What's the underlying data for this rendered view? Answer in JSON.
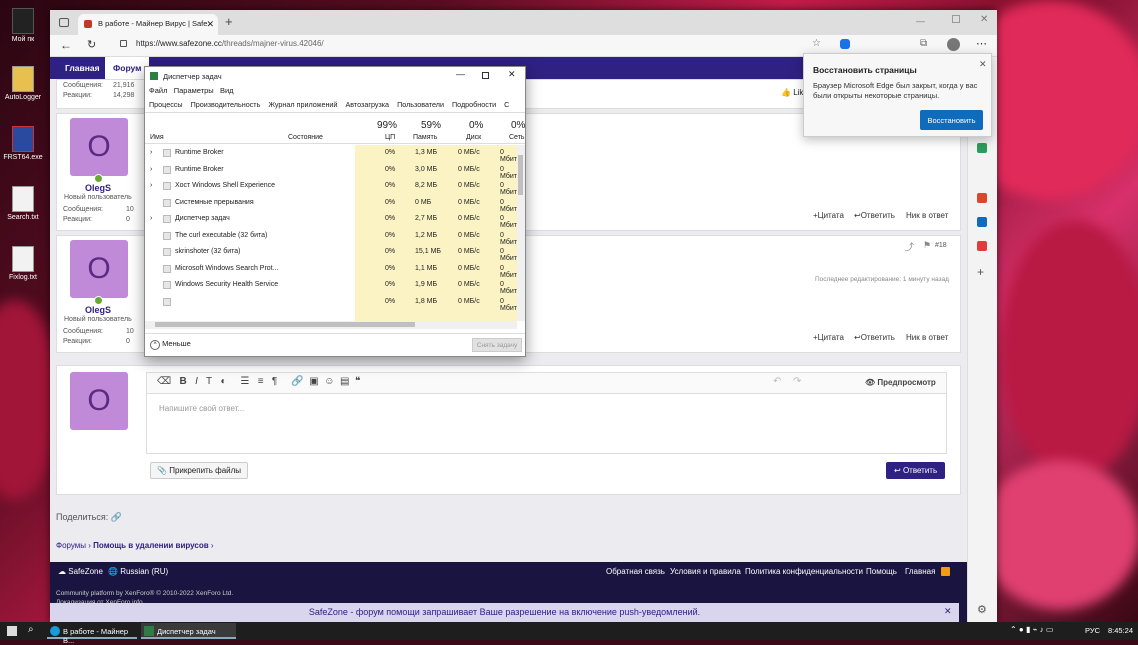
{
  "desktop": {
    "icons": [
      {
        "label": "Мой пк"
      },
      {
        "label": "AutoLogger"
      },
      {
        "label": "FRST64.exe"
      },
      {
        "label": "Search.txt"
      },
      {
        "label": "Fixlog.txt"
      }
    ]
  },
  "browser": {
    "tab_title": "В работе - Майнер Вирус | Safe",
    "url_host": "https://www.safezone.cc",
    "url_path": "/threads/majner-virus.42046/",
    "nav": {
      "home": "Главная",
      "forums": "Форум"
    },
    "like_label": "Like",
    "posts": [
      {
        "user_stats": [
          {
            "k": "Сообщения:",
            "v": "21,916"
          },
          {
            "k": "Реакции:",
            "v": "14,298"
          }
        ]
      },
      {
        "avatar_letter": "O",
        "username": "OlegS",
        "role": "Новый пользователь",
        "stats": [
          {
            "k": "Сообщения:",
            "v": "10"
          },
          {
            "k": "Реакции:",
            "v": "0"
          }
        ],
        "actions": [
          "+Цитата",
          "↩Ответить",
          "Ник в ответ"
        ]
      },
      {
        "avatar_letter": "O",
        "username": "OlegS",
        "role": "Новый пользователь",
        "stats": [
          {
            "k": "Сообщения:",
            "v": "10"
          },
          {
            "k": "Реакции:",
            "v": "0"
          }
        ],
        "actions": [
          "+Цитата",
          "↩Ответить",
          "Ник в ответ"
        ],
        "post_number": "#18",
        "edited": "Последнее редактирование: 1 минуту назад"
      }
    ],
    "reply": {
      "avatar_letter": "O",
      "placeholder": "Напишите свой ответ...",
      "preview": "Предпросмотр",
      "attach": "Прикрепить файлы",
      "submit": "Ответить"
    },
    "share_label": "Поделиться:",
    "breadcrumb": {
      "forums": "Форумы",
      "section": "Помощь в удалении вирусов"
    },
    "footer": {
      "brand": "SafeZone",
      "lang": "Russian (RU)",
      "links": [
        "Обратная связь",
        "Условия и правила",
        "Политика конфиденциальности",
        "Помощь",
        "Главная"
      ],
      "credit1": "Community platform by XenForo® © 2010-2022 XenForo Ltd.",
      "credit2": "Локализация от XenForo.info"
    },
    "push": "SafeZone - форум помощи запрашивает Ваше разрешение на включение push-уведомлений."
  },
  "edge_popup": {
    "title": "Восстановить страницы",
    "body": "Браузер Microsoft Edge был закрыт, когда у вас были открыты некоторые страницы.",
    "button": "Восстановить"
  },
  "taskmgr": {
    "title": "Диспетчер задач",
    "menu": [
      "Файл",
      "Параметры",
      "Вид"
    ],
    "tabs": [
      "Процессы",
      "Производительность",
      "Журнал приложений",
      "Автозагрузка",
      "Пользователи",
      "Подробности",
      "С"
    ],
    "headers": {
      "name": "Имя",
      "status": "Состояние",
      "cpu_pct": "99%",
      "cpu": "ЦП",
      "mem_pct": "59%",
      "mem": "Память",
      "disk_pct": "0%",
      "disk": "Диск",
      "net_pct": "0%",
      "net": "Сеть"
    },
    "rows": [
      {
        "name": "Runtime Broker",
        "cpu": "0%",
        "mem": "1,3 МБ",
        "disk": "0 МБ/с",
        "net": "0 Мбит"
      },
      {
        "name": "Runtime Broker",
        "cpu": "0%",
        "mem": "3,0 МБ",
        "disk": "0 МБ/с",
        "net": "0 Мбит"
      },
      {
        "name": "Хост Windows Shell Experience",
        "cpu": "0%",
        "mem": "8,2 МБ",
        "disk": "0 МБ/с",
        "net": "0 Мбит"
      },
      {
        "name": "Системные прерывания",
        "cpu": "0%",
        "mem": "0 МБ",
        "disk": "0 МБ/с",
        "net": "0 Мбит"
      },
      {
        "name": "Диспетчер задач",
        "cpu": "0%",
        "mem": "2,7 МБ",
        "disk": "0 МБ/с",
        "net": "0 Мбит"
      },
      {
        "name": "The curl executable (32 бита)",
        "cpu": "0%",
        "mem": "1,2 МБ",
        "disk": "0 МБ/с",
        "net": "0 Мбит"
      },
      {
        "name": "skrinshoter (32 бита)",
        "cpu": "0%",
        "mem": "15,1 МБ",
        "disk": "0 МБ/с",
        "net": "0 Мбит"
      },
      {
        "name": "Microsoft Windows Search Prot...",
        "cpu": "0%",
        "mem": "1,1 МБ",
        "disk": "0 МБ/с",
        "net": "0 Мбит"
      },
      {
        "name": "Windows Security Health Service",
        "cpu": "0%",
        "mem": "1,9 МБ",
        "disk": "0 МБ/с",
        "net": "0 Мбит"
      },
      {
        "name": "",
        "cpu": "0%",
        "mem": "1,8 МБ",
        "disk": "0 МБ/с",
        "net": "0 Мбит"
      }
    ],
    "less": "Меньше",
    "end_task": "Снять задачу"
  },
  "taskbar": {
    "items": [
      "В работе - Майнер В...",
      "Диспетчер задач"
    ],
    "lang": "РУС",
    "time": "8:45:24"
  }
}
